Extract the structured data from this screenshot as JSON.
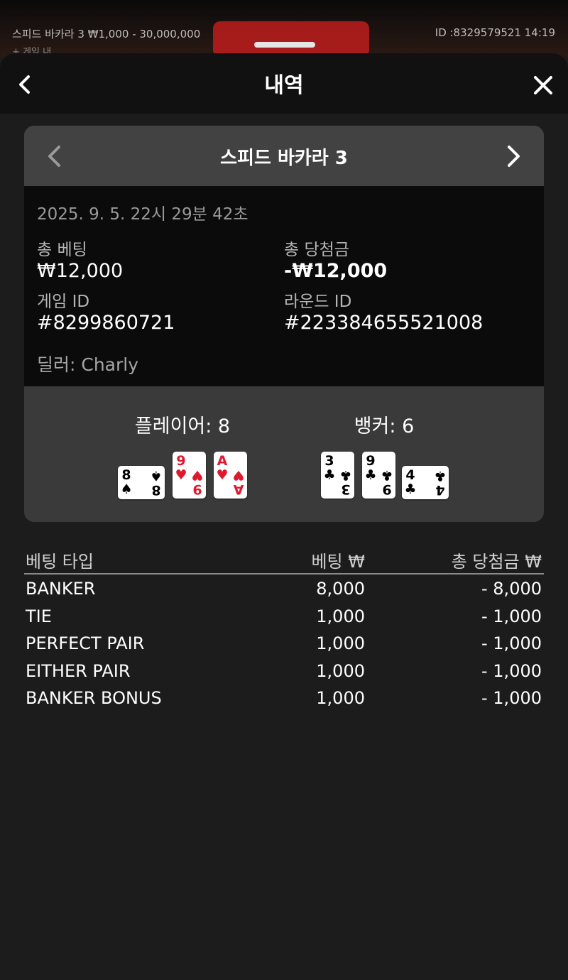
{
  "background_game": {
    "table_info": "스피드 바카라 3 ₩1,000 - 30,000,000",
    "table_info_sub": "+ 게임 내",
    "id_info": "ID :8329579521 14:19"
  },
  "header": {
    "title": "내역"
  },
  "game_card": {
    "name": "스피드 바카라 3",
    "datetime": "2025. 9. 5. 22시 29분 42초",
    "total_bet_label": "총 베팅",
    "total_bet_value": "₩12,000",
    "total_win_label": "총 당첨금",
    "total_win_value": "-₩12,000",
    "game_id_label": "게임 ID",
    "game_id_value": "#8299860721",
    "round_id_label": "라운드 ID",
    "round_id_value": "#223384655521008",
    "dealer": "딜러: Charly"
  },
  "result": {
    "player_label": "플레이어: 8",
    "banker_label": "뱅커: 6",
    "player_cards": [
      {
        "rank": "8",
        "suit": "♠",
        "color": "#000000",
        "orientation": "horizontal"
      },
      {
        "rank": "9",
        "suit": "♥",
        "color": "#e0182d",
        "orientation": "vertical"
      },
      {
        "rank": "A",
        "suit": "♥",
        "color": "#e0182d",
        "orientation": "vertical"
      }
    ],
    "banker_cards": [
      {
        "rank": "3",
        "suit": "♣",
        "color": "#000000",
        "orientation": "vertical"
      },
      {
        "rank": "9",
        "suit": "♣",
        "color": "#000000",
        "orientation": "vertical"
      },
      {
        "rank": "4",
        "suit": "♣",
        "color": "#000000",
        "orientation": "horizontal"
      }
    ]
  },
  "bets_table": {
    "headers": {
      "type": "베팅 타입",
      "bet": "베팅 ₩",
      "win": "총 당첨금 ₩"
    },
    "rows": [
      {
        "type": "BANKER",
        "bet": "8,000",
        "win": "- 8,000"
      },
      {
        "type": "TIE",
        "bet": "1,000",
        "win": "- 1,000"
      },
      {
        "type": "PERFECT PAIR",
        "bet": "1,000",
        "win": "- 1,000"
      },
      {
        "type": "EITHER PAIR",
        "bet": "1,000",
        "win": "- 1,000"
      },
      {
        "type": "BANKER BONUS",
        "bet": "1,000",
        "win": "- 1,000"
      }
    ]
  },
  "colors": {
    "sheet_bg": "#1c1c1c",
    "header_bg": "#111111",
    "card_top": "#424242",
    "info_bg": "#0b0b0b",
    "red_suit": "#e0182d"
  },
  "icons": {
    "back": "chevron-left-icon",
    "close": "close-icon",
    "prev": "chevron-left-icon",
    "next": "chevron-right-icon"
  }
}
